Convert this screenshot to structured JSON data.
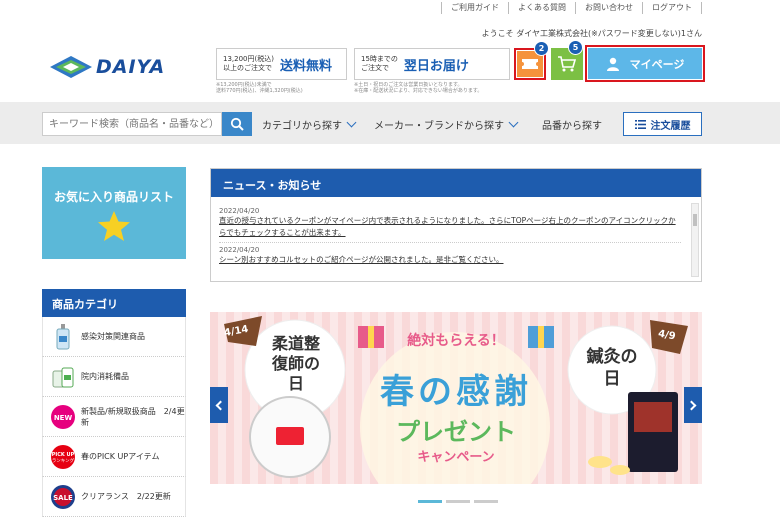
{
  "header": {
    "links": [
      "ご利用ガイド",
      "よくある質問",
      "お問い合わせ",
      "ログアウト"
    ],
    "welcome": "ようこそ ダイヤ工業株式会社(※パスワード変更しない)1さん",
    "logo": "DAIYA"
  },
  "promos": [
    {
      "small1": "13,200円(税込)",
      "small2": "以上のご注文で",
      "big": "送料無料",
      "note": "※13,200円(税込)未満で\n送料770円(税込)、沖縄1,320円(税込)"
    },
    {
      "small1": "15時までの",
      "small2": "ご注文で",
      "big": "翌日お届け",
      "note": "※土日・祝日のご注文は営業日扱いとなります。\n※在庫・配送状況により、対応できない場合があります。"
    }
  ],
  "icons": {
    "coupon_badge": "2",
    "cart_badge": "5",
    "mypage_label": "マイページ"
  },
  "search": {
    "placeholder": "キーワード検索（商品名・品番など）",
    "nav": [
      "カテゴリから探す",
      "メーカー・ブランドから探す",
      "品番から探す"
    ],
    "order_history": "注文履歴"
  },
  "favorites": {
    "title": "お気に入り商品リスト"
  },
  "categories": {
    "title": "商品カテゴリ",
    "items": [
      {
        "label": "感染対策関連商品"
      },
      {
        "label": "院内消耗備品"
      },
      {
        "label": "新製品/新規取扱商品　2/4更新"
      },
      {
        "label": "春のPICK UPアイテム"
      },
      {
        "label": "クリアランス　2/22更新"
      }
    ]
  },
  "news": {
    "title": "ニュース・お知らせ",
    "items": [
      {
        "date": "2022/04/20",
        "text": "直近の授与されているクーポンがマイページ内で表示されるようになりました。さらにTOPページ右上のクーポンのアイコンクリックからでもチェックすることが出来ます。"
      },
      {
        "date": "2022/04/20",
        "text": "シーン別おすすめコルセットのご紹介ページが公開されました。是非ご覧ください。"
      }
    ]
  },
  "banner": {
    "left_title": "柔道整復師の日",
    "left_date": "4/14",
    "right_title": "鍼灸の日",
    "right_date": "4/9",
    "headline": "絶対もらえる！",
    "main": "春の感謝",
    "sub": "プレゼント",
    "campaign": "キャンペーン"
  },
  "colors": {
    "brand_blue": "#1e5cae",
    "sky": "#5bb8d8",
    "highlight_red": "#d9161e",
    "orange": "#f5933c",
    "green": "#7cc044"
  }
}
